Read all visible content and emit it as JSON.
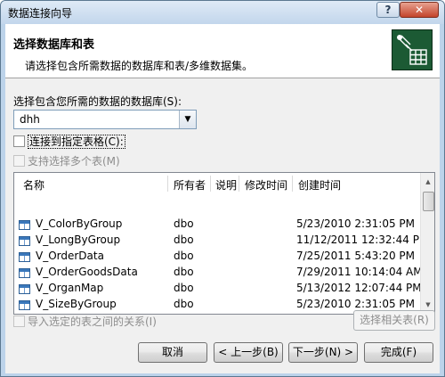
{
  "window": {
    "title": "数据连接向导",
    "help_label": "?",
    "close_label": "✕"
  },
  "header": {
    "title": "选择数据库和表",
    "subtitle": "请选择包含所需数据的数据库和表/多维数据集。",
    "icon": "database-table-icon"
  },
  "database": {
    "label": "选择包含您所需的数据的数据库(S):",
    "value": "dhh"
  },
  "options": {
    "connect_to_table": {
      "label": "连接到指定表格(C):",
      "checked": false
    },
    "multi_select": {
      "label": "支持选择多个表(M)",
      "checked": false,
      "enabled": false
    }
  },
  "table_list": {
    "columns": [
      "名称",
      "所有者",
      "说明",
      "修改时间",
      "创建时间"
    ],
    "rows": [
      {
        "name": "V_ColorByGroup",
        "owner": "dbo",
        "desc": "",
        "modified": "",
        "created": "5/23/2010 2:31:05 PM"
      },
      {
        "name": "V_LongByGroup",
        "owner": "dbo",
        "desc": "",
        "modified": "",
        "created": "11/12/2011 12:32:44 PM"
      },
      {
        "name": "V_OrderData",
        "owner": "dbo",
        "desc": "",
        "modified": "",
        "created": "7/25/2011 5:43:20 PM"
      },
      {
        "name": "V_OrderGoodsData",
        "owner": "dbo",
        "desc": "",
        "modified": "",
        "created": "7/29/2011 10:14:04 AM"
      },
      {
        "name": "V_OrganMap",
        "owner": "dbo",
        "desc": "",
        "modified": "",
        "created": "5/13/2012 12:07:44 PM"
      },
      {
        "name": "V_SizeByGroup",
        "owner": "dbo",
        "desc": "",
        "modified": "",
        "created": "5/23/2010 2:31:05 PM"
      }
    ]
  },
  "relations": {
    "label": "导入选定的表之间的关系(I)",
    "checked": false,
    "enabled": false
  },
  "buttons": {
    "select_related": "选择相关表(R)",
    "cancel": "取消",
    "back": "< 上一步(B)",
    "next": "下一步(N) >",
    "finish": "完成(F)"
  }
}
